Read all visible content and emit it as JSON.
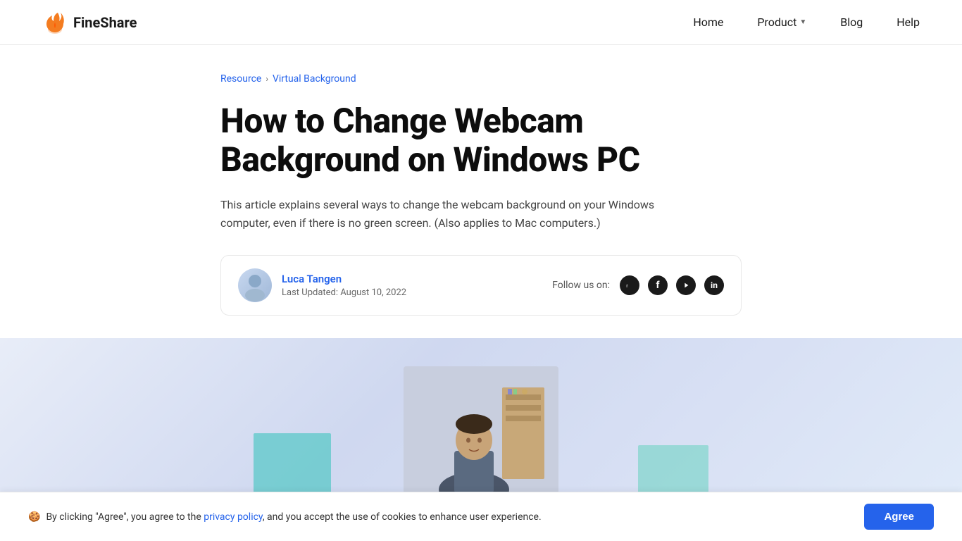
{
  "header": {
    "logo_text": "FineShare",
    "nav": {
      "home_label": "Home",
      "product_label": "Product",
      "blog_label": "Blog",
      "help_label": "Help"
    }
  },
  "breadcrumb": {
    "resource_label": "Resource",
    "separator": "›",
    "virtual_bg_label": "Virtual Background"
  },
  "article": {
    "title": "How to Change Webcam Background on Windows PC",
    "description": "This article explains several ways to change the webcam background on your Windows computer, even if there is no green screen. (Also applies to Mac computers.)",
    "author": {
      "name": "Luca Tangen",
      "last_updated_label": "Last Updated: August 10, 2022"
    },
    "social": {
      "follow_label": "Follow us on:"
    }
  },
  "cookie": {
    "emoji": "🍪",
    "text": " By clicking \"Agree\", you agree to the ",
    "privacy_label": "privacy policy",
    "text2": ", and you accept the use of cookies to enhance user experience.",
    "agree_label": "Agree"
  }
}
